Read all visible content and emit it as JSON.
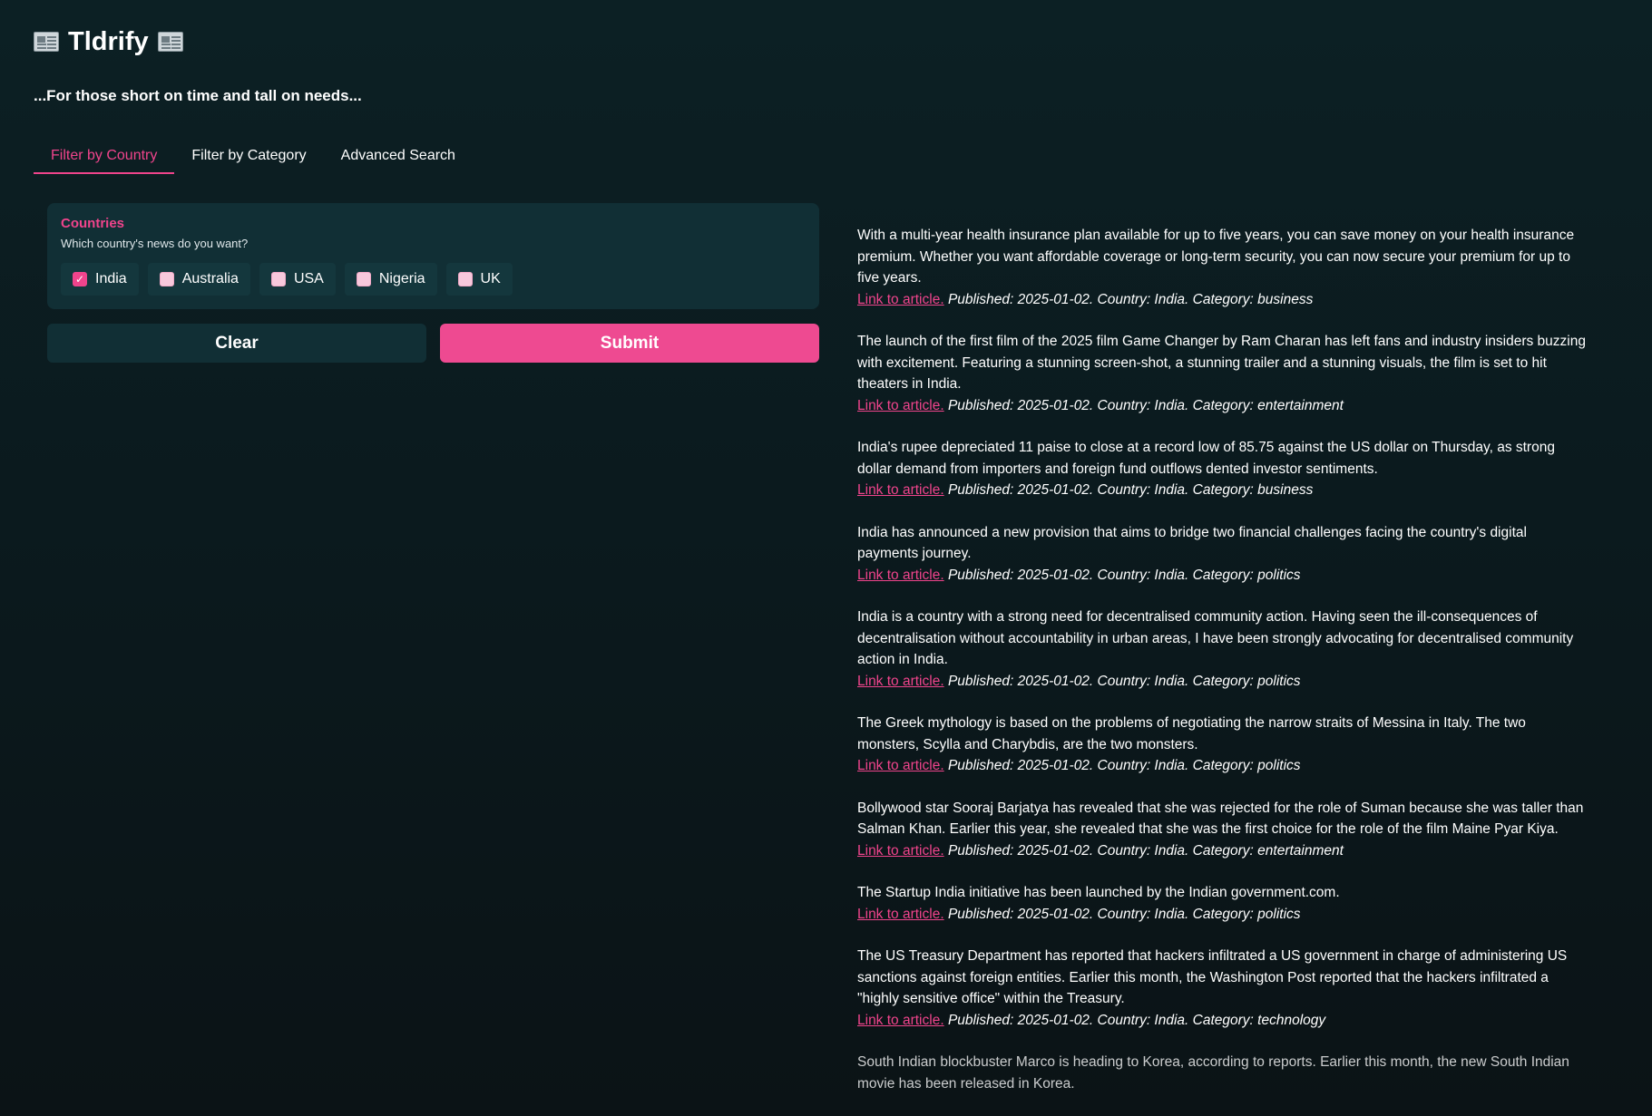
{
  "app": {
    "title": "Tldrify",
    "subtitle": "...For those short on time and tall on needs..."
  },
  "tabs": [
    {
      "label": "Filter by Country",
      "active": true
    },
    {
      "label": "Filter by Category",
      "active": false
    },
    {
      "label": "Advanced Search",
      "active": false
    }
  ],
  "countries": {
    "title": "Countries",
    "description": "Which country's news do you want?",
    "options": [
      {
        "label": "India",
        "checked": true
      },
      {
        "label": "Australia",
        "checked": false
      },
      {
        "label": "USA",
        "checked": false
      },
      {
        "label": "Nigeria",
        "checked": false
      },
      {
        "label": "UK",
        "checked": false
      }
    ]
  },
  "buttons": {
    "clear": "Clear",
    "submit": "Submit"
  },
  "colors": {
    "accent": "#f0448c",
    "panel": "#112f35",
    "background": "#0c1d21"
  },
  "articles": [
    {
      "summary": "With a multi-year health insurance plan available for up to five years, you can save money on your health insurance premium. Whether you want affordable coverage or long-term security, you can now secure your premium for up to five years.",
      "link": "Link to article.",
      "meta": "Published: 2025-01-02. Country: India. Category: business"
    },
    {
      "summary": "The launch of the first film of the 2025 film Game Changer by Ram Charan has left fans and industry insiders buzzing with excitement. Featuring a stunning screen-shot, a stunning trailer and a stunning visuals, the film is set to hit theaters in India.",
      "link": "Link to article.",
      "meta": "Published: 2025-01-02. Country: India. Category: entertainment"
    },
    {
      "summary": "India's rupee depreciated 11 paise to close at a record low of 85.75 against the US dollar on Thursday, as strong dollar demand from importers and foreign fund outflows dented investor sentiments.",
      "link": "Link to article.",
      "meta": "Published: 2025-01-02. Country: India. Category: business"
    },
    {
      "summary": "India has announced a new provision that aims to bridge two financial challenges facing the country's digital payments journey.",
      "link": "Link to article.",
      "meta": "Published: 2025-01-02. Country: India. Category: politics"
    },
    {
      "summary": "India is a country with a strong need for decentralised community action. Having seen the ill-consequences of decentralisation without accountability in urban areas, I have been strongly advocating for decentralised community action in India.",
      "link": "Link to article.",
      "meta": "Published: 2025-01-02. Country: India. Category: politics"
    },
    {
      "summary": "The Greek mythology is based on the problems of negotiating the narrow straits of Messina in Italy. The two monsters, Scylla and Charybdis, are the two monsters.",
      "link": "Link to article.",
      "meta": "Published: 2025-01-02. Country: India. Category: politics"
    },
    {
      "summary": "Bollywood star Sooraj Barjatya has revealed that she was rejected for the role of Suman because she was taller than Salman Khan. Earlier this year, she revealed that she was the first choice for the role of the film Maine Pyar Kiya.",
      "link": "Link to article.",
      "meta": "Published: 2025-01-02. Country: India. Category: entertainment"
    },
    {
      "summary": "The Startup India initiative has been launched by the Indian government.com.",
      "link": "Link to article.",
      "meta": "Published: 2025-01-02. Country: India. Category: politics"
    },
    {
      "summary": "The US Treasury Department has reported that hackers infiltrated a US government in charge of administering US sanctions against foreign entities. Earlier this month, the Washington Post reported that the hackers infiltrated a \"highly sensitive office\" within the Treasury.",
      "link": "Link to article.",
      "meta": "Published: 2025-01-02. Country: India. Category: technology"
    },
    {
      "summary": "South Indian blockbuster Marco is heading to Korea, according to reports. Earlier this month, the new South Indian movie has been released in Korea.",
      "link": "",
      "meta": ""
    }
  ]
}
